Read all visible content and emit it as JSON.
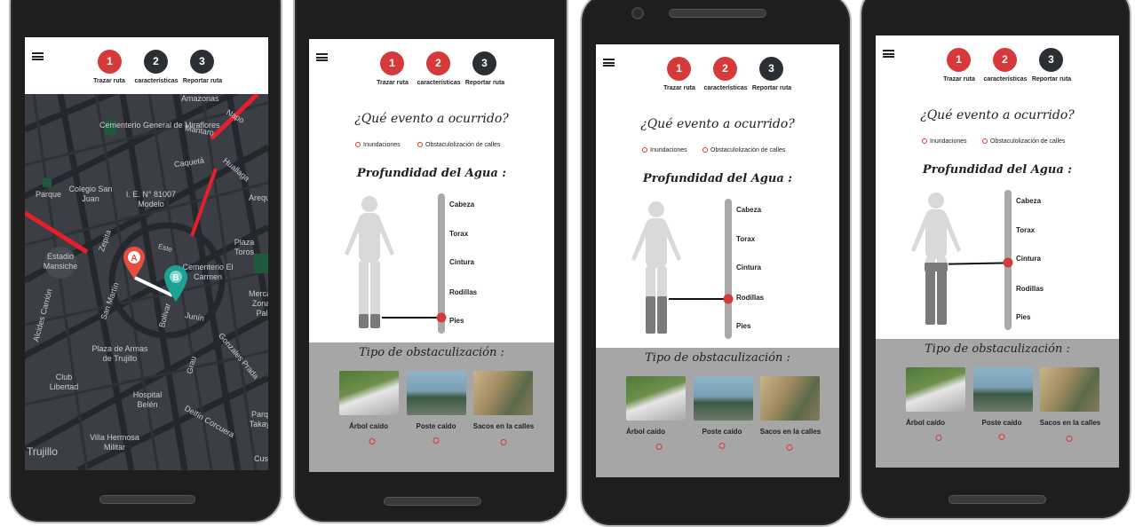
{
  "steps": [
    {
      "number": "1",
      "label": "Trazar ruta"
    },
    {
      "number": "2",
      "label": "características"
    },
    {
      "number": "3",
      "label": "Reportar ruta"
    }
  ],
  "map": {
    "labels": [
      "Cementerio General de Miraflores",
      "Colegio San Juan",
      "I. E. N° 81007 Modelo",
      "Caquetá",
      "Mantaro",
      "Napo",
      "Huallaga",
      "Arequ",
      "Parque",
      "Plaza Toros",
      "Estadio Mansiche",
      "Zepita",
      "Este",
      "Cementerio El Carmen",
      "San Martín",
      "Bolívar",
      "Junín",
      "Alcides Carrión",
      "Plaza de Armas de Trujillo",
      "Club Libertad",
      "Hospital Belén",
      "Grau",
      "Gonzales Prada",
      "Delfín Corcuera",
      "Villa Hermosa Militar",
      "Mercado Zonal Pal",
      "Parqu Takayn",
      "Cusco",
      "Trujillo",
      "Amazonas"
    ],
    "marker_a": "A",
    "marker_b": "B",
    "colors": {
      "marker_a": "#e74c3c",
      "marker_b": "#1aa394",
      "route": "#ffffff",
      "traffic": "#e5202a"
    }
  },
  "question": "¿Qué evento a ocurrido?",
  "options": [
    "Inundaciones",
    "Obstaculolización de calles"
  ],
  "depth_title": "Profundidad del Agua :",
  "depth_levels": [
    "Cabeza",
    "Torax",
    "Cintura",
    "Rodillas",
    "Pies"
  ],
  "screens_selected_level": [
    "Pies",
    "Rodillas",
    "Cintura"
  ],
  "obstacle_title": "Tipo de obstaculización :",
  "obstacles": [
    {
      "label": "Árbol caído",
      "icon": "fallen-tree-photo"
    },
    {
      "label": "Poste caído",
      "icon": "fallen-pole-photo"
    },
    {
      "label": "Sacos en la calles",
      "icon": "sandbags-photo"
    }
  ],
  "accent": "#d7393b",
  "dark": "#2b2f33"
}
